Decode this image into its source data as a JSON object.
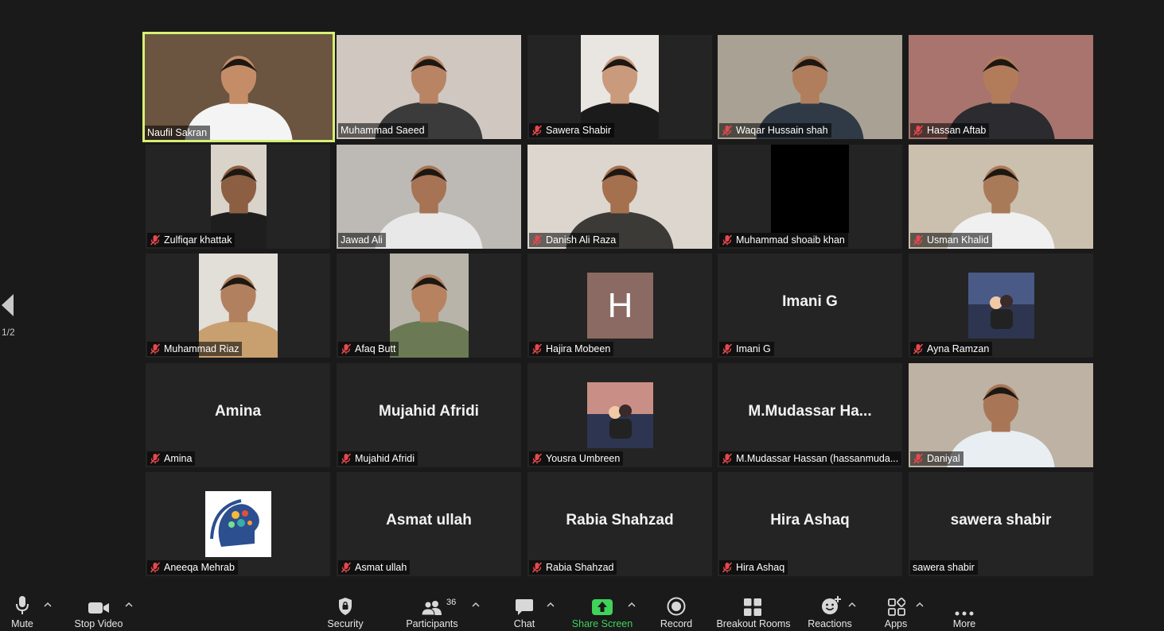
{
  "pager": {
    "label": "1/2"
  },
  "tiles": [
    {
      "name": "Naufil Sakran",
      "muted": false,
      "active": true,
      "kind": "video",
      "bg": "#6b5440",
      "skin": "#c48d67",
      "shirt": "#f4f4f4"
    },
    {
      "name": "Muhammad Saeed",
      "muted": false,
      "kind": "video",
      "bg": "#cfc7c0",
      "skin": "#b98464",
      "shirt": "#3b3b3b"
    },
    {
      "name": "Sawera Shabir",
      "muted": true,
      "kind": "video",
      "bg": "#e9e5e1",
      "skin": "#c99a7c",
      "shirt": "#1b1b1b"
    },
    {
      "name": "Waqar Hussain shah",
      "muted": true,
      "kind": "video",
      "bg": "#a9a294",
      "skin": "#b07e5c",
      "shirt": "#2f3a46"
    },
    {
      "name": "Hassan Aftab",
      "muted": true,
      "kind": "video",
      "bg": "#a8746d",
      "skin": "#b27c5b",
      "shirt": "#2b2b30"
    },
    {
      "name": "Zulfiqar khattak",
      "muted": true,
      "kind": "video",
      "bg": "#d9d3ca",
      "skin": "#8c5e42",
      "shirt": "#1e1e1e"
    },
    {
      "name": "Jawad Ali",
      "muted": false,
      "kind": "video",
      "bg": "#bdbab6",
      "skin": "#a67454",
      "shirt": "#e8e8e8"
    },
    {
      "name": "Danish Ali Raza",
      "muted": true,
      "kind": "video",
      "bg": "#dcd6ce",
      "skin": "#a5704d",
      "shirt": "#3b3a37"
    },
    {
      "name": "Muhammad shoaib khan",
      "muted": true,
      "kind": "black"
    },
    {
      "name": "Usman Khalid",
      "muted": true,
      "kind": "video",
      "bg": "#cbbfae",
      "skin": "#a97a58",
      "shirt": "#f0f0f0"
    },
    {
      "name": "Muhammad Riaz",
      "muted": true,
      "kind": "video",
      "bg": "#e2ded8",
      "skin": "#b1805e",
      "shirt": "#c8a070"
    },
    {
      "name": "Afaq Butt",
      "muted": true,
      "kind": "video",
      "bg": "#b8b4aa",
      "skin": "#b68260",
      "shirt": "#6b7a55"
    },
    {
      "name": "Hajira Mobeen",
      "muted": true,
      "kind": "letter",
      "letter": "H"
    },
    {
      "name": "Imani G",
      "muted": true,
      "kind": "text",
      "display": "Imani G"
    },
    {
      "name": "Ayna Ramzan",
      "muted": true,
      "kind": "picture",
      "bg": "#4a5a86"
    },
    {
      "name": "Amina",
      "muted": true,
      "kind": "text",
      "display": "Amina"
    },
    {
      "name": "Mujahid Afridi",
      "muted": true,
      "kind": "text",
      "display": "Mujahid Afridi"
    },
    {
      "name": "Yousra Umbreen",
      "muted": true,
      "kind": "picture",
      "bg": "#c98f86"
    },
    {
      "name": "M.Mudassar Hassan (hassanmuda...",
      "muted": true,
      "kind": "text",
      "display": "M.Mudassar  Ha..."
    },
    {
      "name": "Daniyal",
      "muted": true,
      "kind": "video",
      "bg": "#bdb2a3",
      "skin": "#a87656",
      "shirt": "#e9eef2"
    },
    {
      "name": "Aneeqa Mehrab",
      "muted": true,
      "kind": "brain"
    },
    {
      "name": "Asmat ullah",
      "muted": true,
      "kind": "text",
      "display": "Asmat ullah"
    },
    {
      "name": "Rabia Shahzad",
      "muted": true,
      "kind": "text",
      "display": "Rabia Shahzad"
    },
    {
      "name": "Hira Ashaq",
      "muted": true,
      "kind": "text",
      "display": "Hira Ashaq"
    },
    {
      "name": "sawera shabir",
      "muted": false,
      "kind": "text",
      "display": "sawera shabir"
    }
  ],
  "toolbar": {
    "mute": "Mute",
    "stop_video": "Stop Video",
    "security": "Security",
    "participants": "Participants",
    "participants_count": "36",
    "chat": "Chat",
    "share_screen": "Share Screen",
    "record": "Record",
    "breakout_rooms": "Breakout Rooms",
    "reactions": "Reactions",
    "apps": "Apps",
    "more": "More"
  },
  "colors": {
    "active_border": "#d6f073",
    "share_green": "#3fd35a",
    "muted_red": "#e5484d"
  }
}
